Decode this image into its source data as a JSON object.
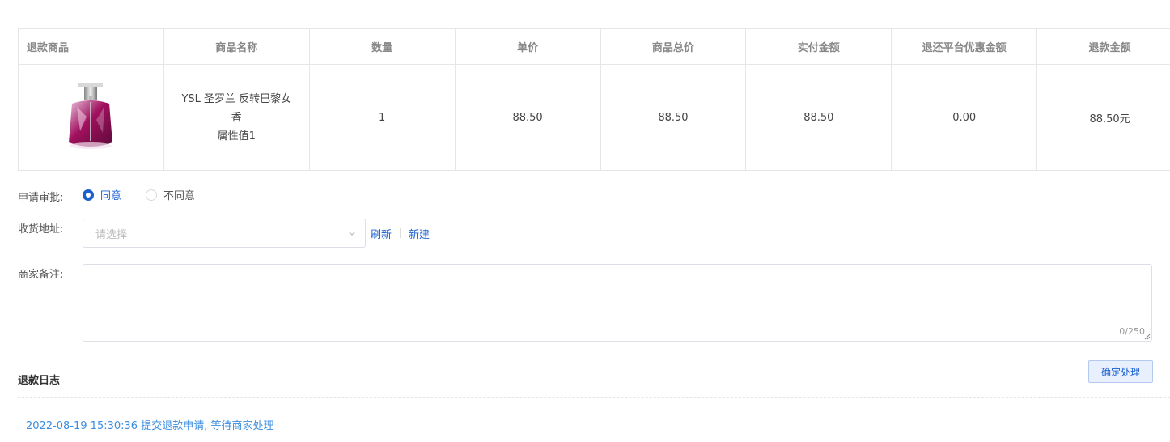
{
  "table": {
    "headers": [
      "退款商品",
      "商品名称",
      "数量",
      "单价",
      "商品总价",
      "实付金额",
      "退还平台优惠金额",
      "退款金额"
    ],
    "row": {
      "product_image": "perfume-bottle",
      "product_name_line1": "YSL 圣罗兰 反转巴黎女",
      "product_name_line2": "香",
      "product_attribute": "属性值1",
      "quantity": "1",
      "unit_price": "88.50",
      "total_price": "88.50",
      "paid_amount": "88.50",
      "platform_discount_refund": "0.00",
      "refund_amount": "88.50元"
    }
  },
  "approval": {
    "label": "申请审批:",
    "options": [
      "同意",
      "不同意"
    ],
    "selected": "同意"
  },
  "address": {
    "label": "收货地址:",
    "placeholder": "请选择",
    "refresh_label": "刷新",
    "new_label": "新建"
  },
  "remark": {
    "label": "商家备注:",
    "counter": "0/250"
  },
  "confirm_button_label": "确定处理",
  "log": {
    "title": "退款日志",
    "entries": [
      "2022-08-19 15:30:36 提交退款申请, 等待商家处理"
    ]
  },
  "colors": {
    "accent": "#1a5fd0",
    "log_link": "#3d8ee0",
    "border": "#e6e6e6"
  }
}
